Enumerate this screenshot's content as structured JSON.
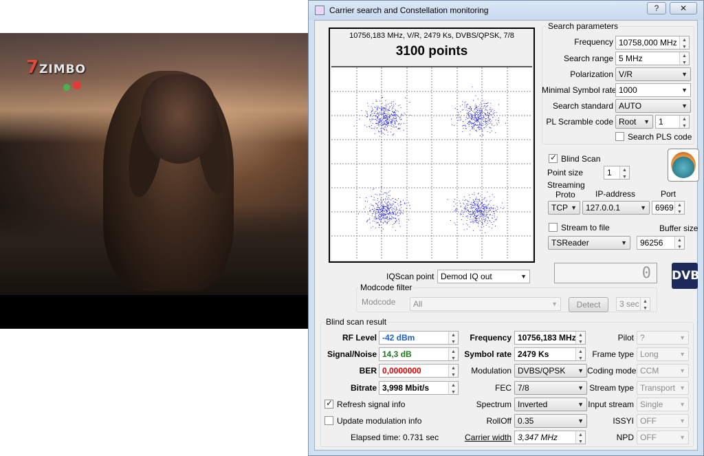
{
  "window": {
    "title": "Carrier search and Constellation monitoring",
    "help_label": "?",
    "close_label": "✕"
  },
  "video": {
    "logo_text": "ZIMBO",
    "logo_number": "7"
  },
  "constellation": {
    "info": "10756,183 MHz, V/R, 2479 Ks, DVBS/QPSK, 7/8",
    "points": "3100 points"
  },
  "search_params": {
    "title": "Search parameters",
    "frequency_label": "Frequency",
    "frequency_value": "10758,000 MHz",
    "range_label": "Search range",
    "range_value": "5 MHz",
    "polarization_label": "Polarization",
    "polarization_value": "V/R",
    "min_sr_label": "Minimal Symbol rate",
    "min_sr_value": "1000",
    "standard_label": "Search standard",
    "standard_value": "AUTO",
    "pl_label": "PL Scramble code",
    "pl_type": "Root",
    "pl_value": "1",
    "search_pls_label": "Search PLS code"
  },
  "blind": {
    "blind_scan_label": "Blind Scan",
    "point_size_label": "Point size",
    "point_size_value": "1"
  },
  "streaming": {
    "title": "Streaming",
    "proto_label": "Proto",
    "ip_label": "IP-address",
    "port_label": "Port",
    "proto_value": "TCP",
    "ip_value": "127.0.0.1",
    "port_value": "6969",
    "stream_to_file_label": "Stream to file",
    "buffer_label": "Buffer size",
    "reader_value": "TSReader",
    "buffer_value": "96256"
  },
  "iq": {
    "label": "IQScan point",
    "value": "Demod IQ out",
    "display": "0"
  },
  "dvb_logo": "DVB",
  "modcode": {
    "title": "Modcode filter",
    "label": "Modcode",
    "value": "All",
    "detect_label": "Detect",
    "time_value": "3 sec"
  },
  "result": {
    "title": "Blind scan result",
    "rf_label": "RF Level",
    "rf_value": "-42 dBm",
    "sn_label": "Signal/Noise",
    "sn_value": "14,3 dB",
    "ber_label": "BER",
    "ber_value": "0,0000000",
    "bitrate_label": "Bitrate",
    "bitrate_value": "3,998 Mbit/s",
    "refresh_label": "Refresh signal info",
    "update_label": "Update modulation info",
    "elapsed_label": "Elapsed time: 0.731 sec",
    "freq_label": "Frequency",
    "freq_value": "10756,183 MHz",
    "sr_label": "Symbol rate",
    "sr_value": "2479 Ks",
    "mod_label": "Modulation",
    "mod_value": "DVBS/QPSK",
    "fec_label": "FEC",
    "fec_value": "7/8",
    "spectrum_label": "Spectrum",
    "spectrum_value": "Inverted",
    "rolloff_label": "RollOff",
    "rolloff_value": "0.35",
    "cw_label": "Carrier width",
    "cw_value": "3,347 MHz",
    "pilot_label": "Pilot",
    "pilot_value": "?",
    "frame_label": "Frame type",
    "frame_value": "Long",
    "coding_label": "Coding mode",
    "coding_value": "CCM",
    "stream_type_label": "Stream type",
    "stream_type_value": "Transport",
    "input_stream_label": "Input stream",
    "input_stream_value": "Single",
    "issyi_label": "ISSYI",
    "issyi_value": "OFF",
    "npd_label": "NPD",
    "npd_value": "OFF"
  }
}
